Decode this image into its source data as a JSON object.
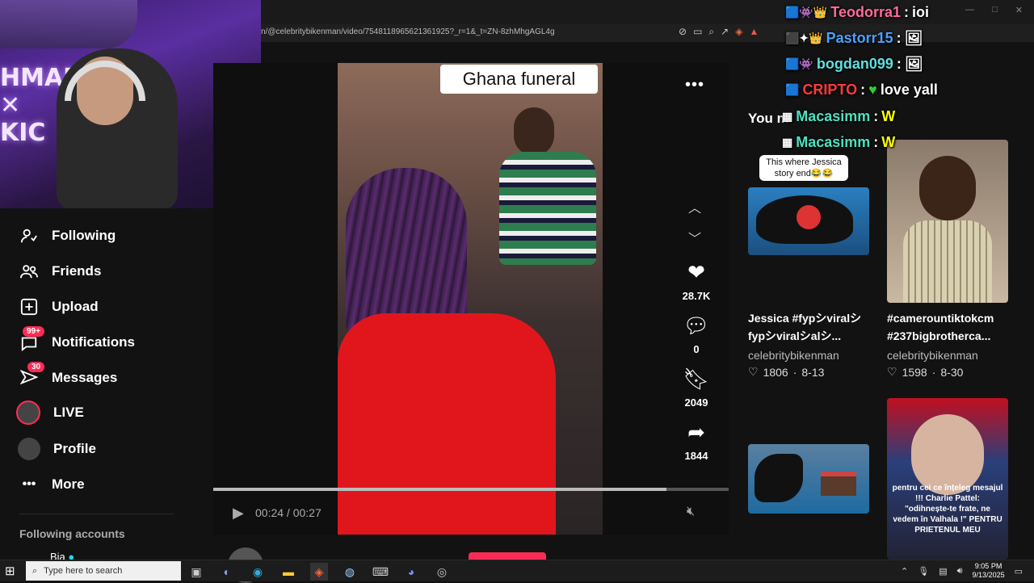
{
  "browser": {
    "url": "n/@celebritybikenman/video/7548118965621361925?_r=1&_t=ZN-8zhMhgAGL4g",
    "toolbar_icons": [
      "bookmark-off-icon",
      "tab-icon",
      "zoom-icon",
      "share-icon",
      "brave-icon",
      "alert-icon"
    ],
    "window_controls": [
      "—",
      "□",
      "✕"
    ]
  },
  "sidebar": {
    "items": [
      {
        "label": "Following",
        "icon": "following-icon"
      },
      {
        "label": "Friends",
        "icon": "friends-icon"
      },
      {
        "label": "Upload",
        "icon": "upload-icon"
      },
      {
        "label": "Notifications",
        "icon": "notifications-icon",
        "badge": "99+"
      },
      {
        "label": "Messages",
        "icon": "messages-icon",
        "badge": "30"
      },
      {
        "label": "LIVE",
        "icon": "live-avatar"
      },
      {
        "label": "Profile",
        "icon": "profile-avatar"
      },
      {
        "label": "More",
        "icon": "more-dots-icon"
      }
    ],
    "following_header": "Following accounts",
    "following_first": "Bia"
  },
  "video": {
    "caption": "Ghana funeral",
    "time_current": "00:24",
    "time_total": "00:27",
    "progress": 0.88,
    "likes": "28.7K",
    "comments": "0",
    "saves": "2049",
    "shares": "1844",
    "author": "celebritybikenman"
  },
  "right_panel": {
    "heading_partial": "You m",
    "cards": [
      {
        "overlay": "This where Jessica story end😂😂",
        "title": "Jessica #fypシviralシ fypシviralシalシ...",
        "user": "celebritybikenman",
        "likes": "1806",
        "date": "8-13"
      },
      {
        "overlay": "",
        "title": "#camerountiktokcm #237bigbrotherca...",
        "user": "celebritybikenman",
        "likes": "1598",
        "date": "8-30"
      },
      {
        "overlay": "",
        "title": "",
        "user": "",
        "likes": "",
        "date": ""
      },
      {
        "overlay": "pentru cei ce înțeleg mesajul !!! Charlie Pattel: \"odihnește-te frate, ne vedem în Valhala !\" PENTRU PRIETENUL MEU",
        "title": "",
        "user": "",
        "likes": "",
        "date": ""
      }
    ]
  },
  "chat": [
    {
      "user": "Teodorra1",
      "text": "ioi",
      "color": "#ff6b9a"
    },
    {
      "user": "Pastorr15",
      "text": "",
      "color": "#4aa3ff"
    },
    {
      "user": "bogdan099",
      "text": "",
      "color": "#5ee0e0"
    },
    {
      "user": "CRIPTO",
      "text": "love yall",
      "color": "#ff3b3b"
    },
    {
      "user": "Macasimm",
      "text": "W",
      "color": "#4ee0c0"
    },
    {
      "user": "Macasimm",
      "text": "W",
      "color": "#4ee0c0"
    }
  ],
  "taskbar": {
    "search_placeholder": "Type here to search",
    "time": "9:05 PM",
    "date": "9/13/2025"
  },
  "colors": {
    "accent": "#fe2c55",
    "background": "#121212"
  }
}
